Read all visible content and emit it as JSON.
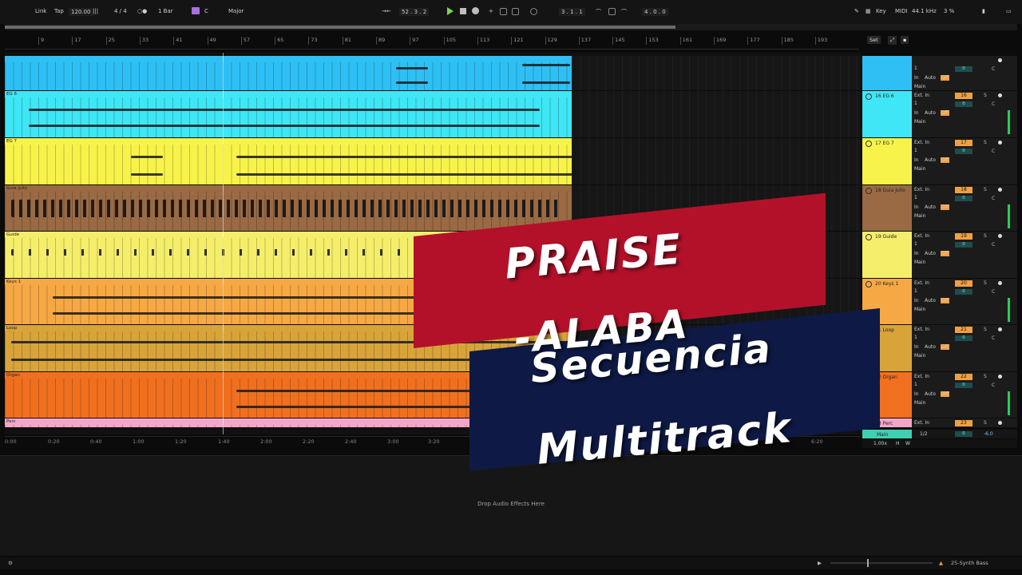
{
  "topbar": {
    "link": "Link",
    "tap": "Tap",
    "tempo": "120.00",
    "meter": "4 / 4",
    "quantize": "1 Bar",
    "key": "C",
    "scale": "Major",
    "position": "52 . 3 . 2",
    "loop_start": "3 . 1 . 1",
    "loop_length": "4 . 0 . 0",
    "key_btn": "Key",
    "midi_btn": "MIDI",
    "sample_rate": "44.1 kHz",
    "cpu": "3 %"
  },
  "ruler": {
    "ticks": [
      "9",
      "17",
      "25",
      "33",
      "41",
      "49",
      "57",
      "65",
      "73",
      "81",
      "89",
      "97",
      "105",
      "113",
      "121",
      "129",
      "137",
      "145",
      "153",
      "161",
      "169",
      "177",
      "185",
      "193"
    ],
    "set_label": "Set"
  },
  "tracks": [
    {
      "clip_name": "",
      "header_name": "",
      "number": "",
      "color": "#2ec0f5",
      "input": "",
      "volume": "0"
    },
    {
      "clip_name": "EG 6",
      "header_name": "16 EG 6",
      "number": "16",
      "color": "#3fe6f5",
      "input": "Ext. In",
      "volume": "0"
    },
    {
      "clip_name": "EG 7",
      "header_name": "17 EG 7",
      "number": "17",
      "color": "#f7f34a",
      "input": "Ext. In",
      "volume": "0"
    },
    {
      "clip_name": "Guia Julio",
      "header_name": "18 Guia Julio",
      "number": "18",
      "color": "#9a6a44",
      "input": "Ext. In",
      "volume": "0"
    },
    {
      "clip_name": "Guide",
      "header_name": "19 Guide",
      "number": "19",
      "color": "#f5ee6a",
      "input": "Ext. In",
      "volume": "0"
    },
    {
      "clip_name": "Keys 1",
      "header_name": "20 Keys 1",
      "number": "20",
      "color": "#f6a844",
      "input": "Ext. In",
      "volume": "0"
    },
    {
      "clip_name": "Loop",
      "header_name": "21 Loop",
      "number": "21",
      "color": "#d8a43a",
      "input": "Ext. In",
      "volume": "0"
    },
    {
      "clip_name": "Organ",
      "header_name": "22 Organ",
      "number": "22",
      "color": "#f07020",
      "input": "Ext. In",
      "volume": "0"
    },
    {
      "clip_name": "Perc",
      "header_name": "23 Perc",
      "number": "23",
      "color": "#f3a6c8",
      "input": "Ext. In",
      "volume": "0"
    }
  ],
  "track_labels": {
    "channel": "1",
    "in": "In",
    "auto": "Auto",
    "off": "Off",
    "output": "Main",
    "solo": "S",
    "cue": "C",
    "main_label": "Main",
    "main_ratio": "1/2",
    "main_vol": "-6.0",
    "zoom": "1.00x",
    "h_btn": "H",
    "w_btn": "W"
  },
  "timeline": [
    "0:00",
    "0:20",
    "0:40",
    "1:00",
    "1:20",
    "1:40",
    "2:00",
    "2:20",
    "2:40",
    "3:00",
    "3:20",
    "6:20"
  ],
  "device_panel": {
    "drop_hint": "Drop Audio Effects Here"
  },
  "statusbar": {
    "device_name": "25-Synth Bass"
  },
  "banner": {
    "line1": "PRAISE",
    "line2": "-ALABA",
    "line3": "Secuencia",
    "line4": "Multitrack",
    "red": "#b3112a",
    "navy": "#0e1a45"
  }
}
